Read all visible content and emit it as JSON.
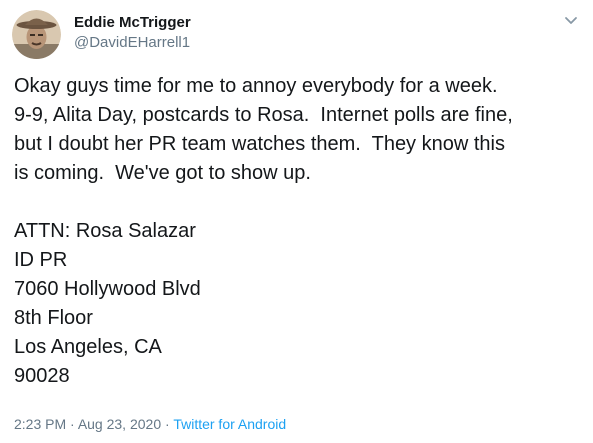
{
  "user": {
    "display_name": "Eddie McTrigger",
    "handle": "@DavidEHarrell1"
  },
  "tweet": {
    "lines": [
      "Okay guys time for me to annoy everybody for a week.",
      "9-9, Alita Day, postcards to Rosa.  Internet polls are fine,",
      "but I doubt her PR team watches them.  They know this",
      "is coming.  We've got to show up.",
      "",
      "ATTN: Rosa Salazar",
      "ID PR",
      "7060 Hollywood Blvd",
      "8th Floor",
      "Los Angeles, CA",
      "90028"
    ],
    "time": "2:23 PM",
    "separator_1": " · ",
    "date": "Aug 23, 2020",
    "separator_2": " · ",
    "source": "Twitter for Android"
  },
  "icons": {
    "menu": "chevron-down-icon",
    "avatar": "avatar"
  },
  "colors": {
    "text": "#14171a",
    "secondary": "#657786",
    "link": "#1da1f2"
  }
}
